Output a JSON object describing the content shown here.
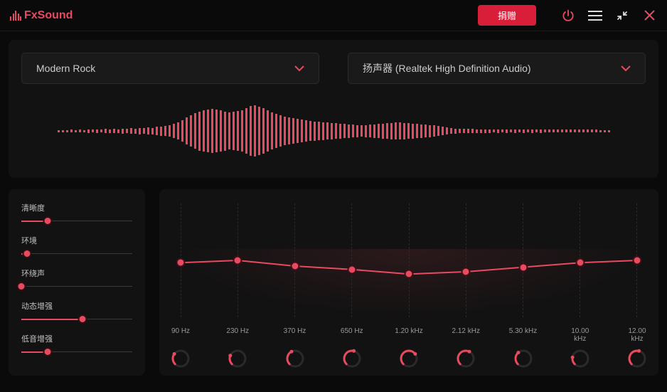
{
  "app": {
    "name": "FxSound"
  },
  "header": {
    "donate_label": "捐赠"
  },
  "selectors": {
    "preset": "Modern Rock",
    "device": "扬声器 (Realtek High Definition Audio)"
  },
  "spectrum_bars": [
    3,
    3,
    3,
    4,
    3,
    4,
    3,
    5,
    4,
    5,
    4,
    6,
    5,
    6,
    5,
    7,
    6,
    8,
    7,
    9,
    8,
    10,
    9,
    12,
    13,
    14,
    16,
    20,
    24,
    30,
    38,
    44,
    50,
    55,
    58,
    60,
    62,
    60,
    58,
    55,
    52,
    54,
    56,
    58,
    64,
    70,
    72,
    68,
    64,
    58,
    52,
    48,
    44,
    40,
    38,
    36,
    34,
    32,
    30,
    28,
    27,
    26,
    25,
    24,
    23,
    22,
    21,
    20,
    19,
    18,
    17,
    16,
    17,
    18,
    19,
    20,
    21,
    22,
    23,
    24,
    24,
    23,
    22,
    21,
    20,
    19,
    18,
    17,
    16,
    14,
    12,
    10,
    8,
    7,
    6,
    6,
    6,
    6,
    5,
    5,
    5,
    5,
    4,
    5,
    4,
    5,
    4,
    5,
    4,
    5,
    4,
    5,
    4,
    5,
    4,
    4,
    4,
    4,
    4,
    4,
    4,
    4,
    4,
    4,
    4,
    4,
    4,
    3,
    3,
    3
  ],
  "effects": [
    {
      "label": "清晰度",
      "value": 0.24
    },
    {
      "label": "环境",
      "value": 0.05
    },
    {
      "label": "环绕声",
      "value": 0.0
    },
    {
      "label": "动态增强",
      "value": 0.55
    },
    {
      "label": "低音增强",
      "value": 0.24
    }
  ],
  "eq": {
    "bands": [
      {
        "label": "90 Hz",
        "y": 0.52,
        "knob": 0.3
      },
      {
        "label": "230 Hz",
        "y": 0.5,
        "knob": 0.25
      },
      {
        "label": "370 Hz",
        "y": 0.55,
        "knob": 0.4
      },
      {
        "label": "650 Hz",
        "y": 0.58,
        "knob": 0.55
      },
      {
        "label": "1.20 kHz",
        "y": 0.62,
        "knob": 0.7
      },
      {
        "label": "2.12 kHz",
        "y": 0.6,
        "knob": 0.6
      },
      {
        "label": "5.30 kHz",
        "y": 0.56,
        "knob": 0.35
      },
      {
        "label": "10.00 kHz",
        "y": 0.52,
        "knob": 0.2
      },
      {
        "label": "12.00 kHz",
        "y": 0.5,
        "knob": 0.55
      }
    ]
  }
}
